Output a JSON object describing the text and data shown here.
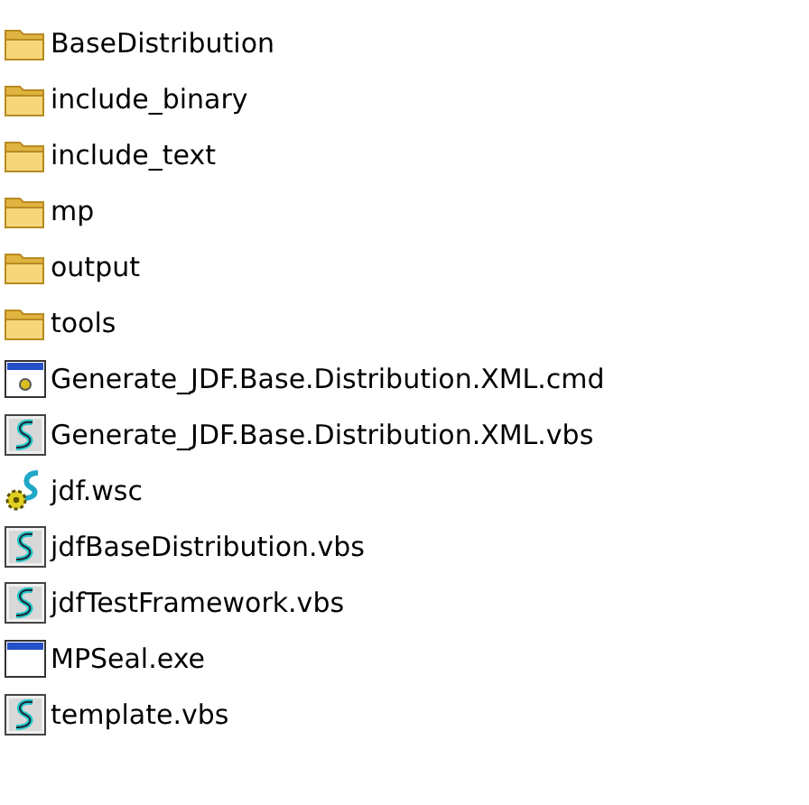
{
  "files": [
    {
      "name": "BaseDistribution",
      "kind": "folder"
    },
    {
      "name": "include_binary",
      "kind": "folder"
    },
    {
      "name": "include_text",
      "kind": "folder"
    },
    {
      "name": "mp",
      "kind": "folder"
    },
    {
      "name": "output",
      "kind": "folder"
    },
    {
      "name": "tools",
      "kind": "folder"
    },
    {
      "name": "Generate_JDF.Base.Distribution.XML.cmd",
      "kind": "batch"
    },
    {
      "name": "Generate_JDF.Base.Distribution.XML.vbs",
      "kind": "script"
    },
    {
      "name": "jdf.wsc",
      "kind": "component"
    },
    {
      "name": "jdfBaseDistribution.vbs",
      "kind": "script"
    },
    {
      "name": "jdfTestFramework.vbs",
      "kind": "script"
    },
    {
      "name": "MPSeal.exe",
      "kind": "program"
    },
    {
      "name": "template.vbs",
      "kind": "script"
    }
  ]
}
